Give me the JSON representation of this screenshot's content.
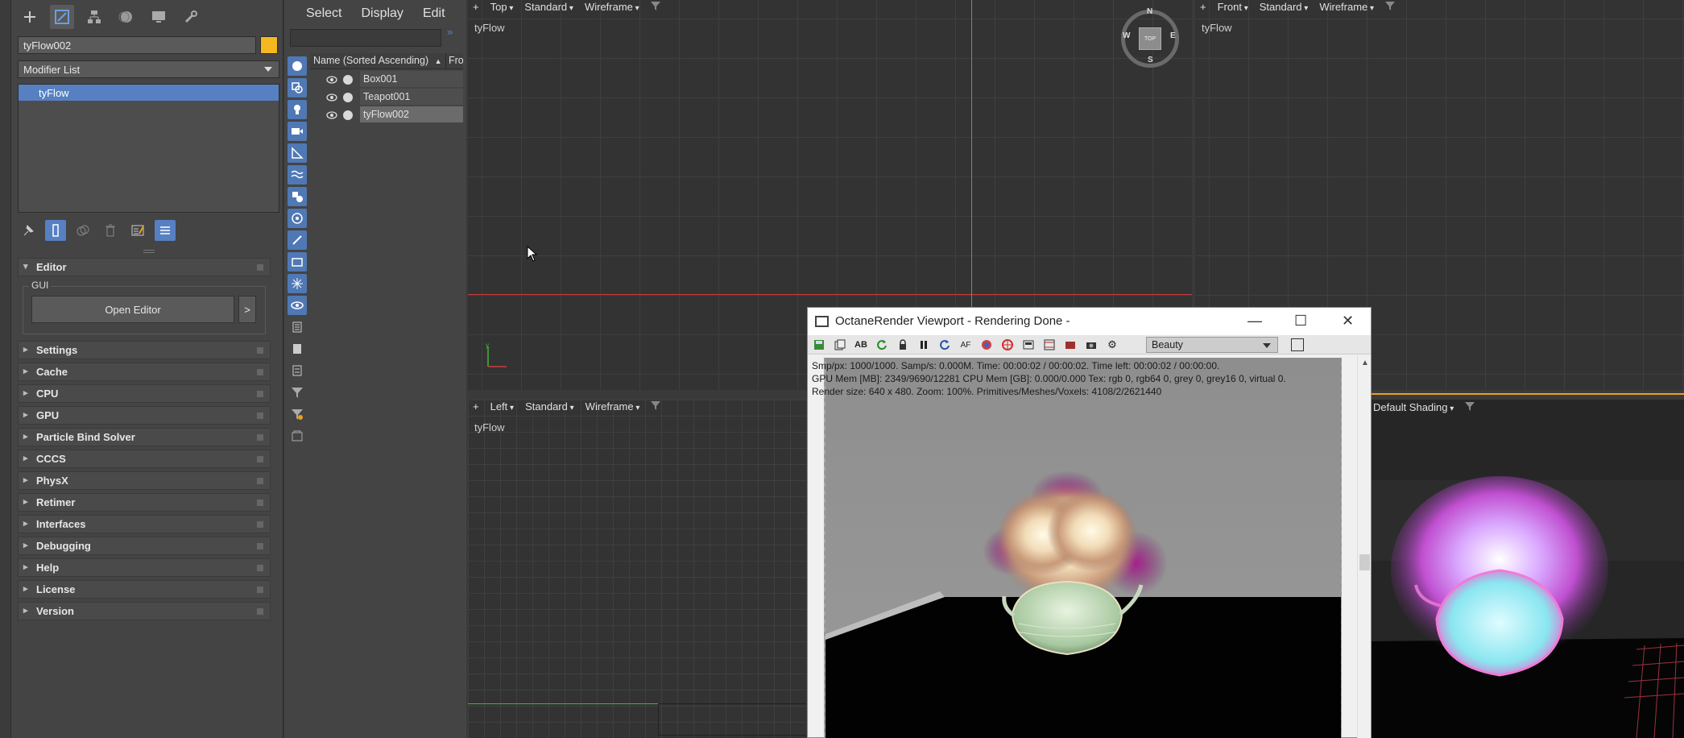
{
  "command_panel": {
    "object_name": "tyFlow002",
    "object_color": "#f5b81e",
    "modifier_list_label": "Modifier List",
    "modifier_stack": [
      "tyFlow"
    ],
    "editor_rollout": {
      "title": "Editor",
      "gui_label": "GUI",
      "open_editor_label": "Open Editor",
      "more_label": ">"
    },
    "rollouts": [
      "Settings",
      "Cache",
      "CPU",
      "GPU",
      "Particle Bind Solver",
      "CCCS",
      "PhysX",
      "Retimer",
      "Interfaces",
      "Debugging",
      "Help",
      "License",
      "Version"
    ]
  },
  "scene_explorer": {
    "menu": [
      "Select",
      "Display",
      "Edit"
    ],
    "column_header": "Name (Sorted Ascending)",
    "sort_glyph": "▲",
    "second_column": "Fro",
    "rows": [
      {
        "name": "Box001"
      },
      {
        "name": "Teapot001"
      },
      {
        "name": "tyFlow002",
        "selected": true
      }
    ]
  },
  "viewports": {
    "top": {
      "plus": "+",
      "view": "Top",
      "shading": "Standard",
      "mode": "Wireframe",
      "object_label": "tyFlow"
    },
    "front": {
      "plus": "+",
      "view": "Front",
      "shading": "Standard",
      "mode": "Wireframe",
      "object_label": "tyFlow"
    },
    "left": {
      "plus": "+",
      "view": "Left",
      "shading": "Standard",
      "mode": "Wireframe",
      "object_label": "tyFlow"
    },
    "perspective": {
      "mode": "Default Shading"
    },
    "viewcube": {
      "face": "TOP",
      "n": "N",
      "s": "S",
      "e": "E",
      "w": "W"
    }
  },
  "octane_window": {
    "title": "OctaneRender Viewport - Rendering Done -",
    "pass_select": "Beauty",
    "info_line1": "Smp/px: 1000/1000.   Samp/s: 0.000M.   Time: 00:00:02 / 00:00:02.   Time left: 00:00:02 / 00:00:00.",
    "info_line2": "GPU Mem [MB]: 2349/9690/12281   CPU Mem [GB]: 0.000/0.000   Tex: rgb 0, rgb64 0, grey 0, grey16 0, virtual 0.",
    "info_line3": "Render size: 640 x 480.   Zoom: 100%.   Primitives/Meshes/Voxels: 4108/2/2621440",
    "minimize": "—",
    "maximize": "☐",
    "close": "✕"
  },
  "colors": {
    "accent_blue": "#5680c2",
    "axis_red": "#c83c3c",
    "axis_green": "#3cb43c"
  }
}
